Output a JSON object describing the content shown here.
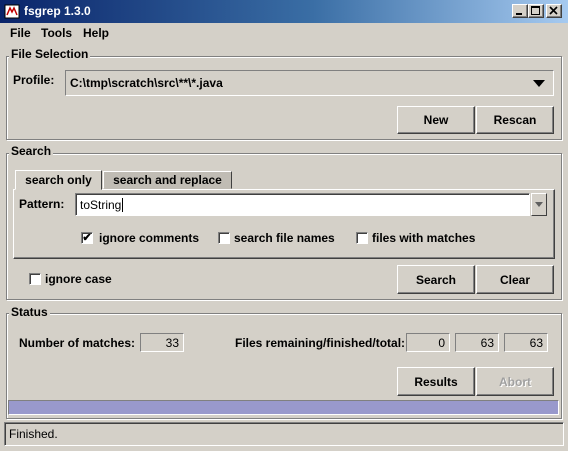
{
  "window": {
    "title": "fsgrep 1.3.0"
  },
  "menu": [
    "File",
    "Tools",
    "Help"
  ],
  "file_selection": {
    "group_title": "File Selection",
    "profile_label": "Profile:",
    "profile_value": "C:\\tmp\\scratch\\src\\**\\*.java",
    "new_label": "New",
    "rescan_label": "Rescan"
  },
  "search": {
    "group_title": "Search",
    "tabs": [
      "search only",
      "search and replace"
    ],
    "pattern_label": "Pattern:",
    "pattern_value": "toString",
    "options": [
      {
        "label": "ignore comments",
        "checked": true
      },
      {
        "label": "search file names",
        "checked": false
      },
      {
        "label": "files with matches",
        "checked": false
      }
    ],
    "ignore_case_label": "ignore case",
    "ignore_case_checked": false,
    "search_label": "Search",
    "clear_label": "Clear"
  },
  "status": {
    "group_title": "Status",
    "matches_label": "Number of matches:",
    "matches_value": "33",
    "files_label": "Files remaining/finished/total:",
    "remaining": "0",
    "finished": "63",
    "total": "63",
    "results_label": "Results",
    "abort_label": "Abort",
    "progress": 1.0,
    "progress_color": "#9999cc"
  },
  "statusbar": {
    "text": "Finished."
  }
}
